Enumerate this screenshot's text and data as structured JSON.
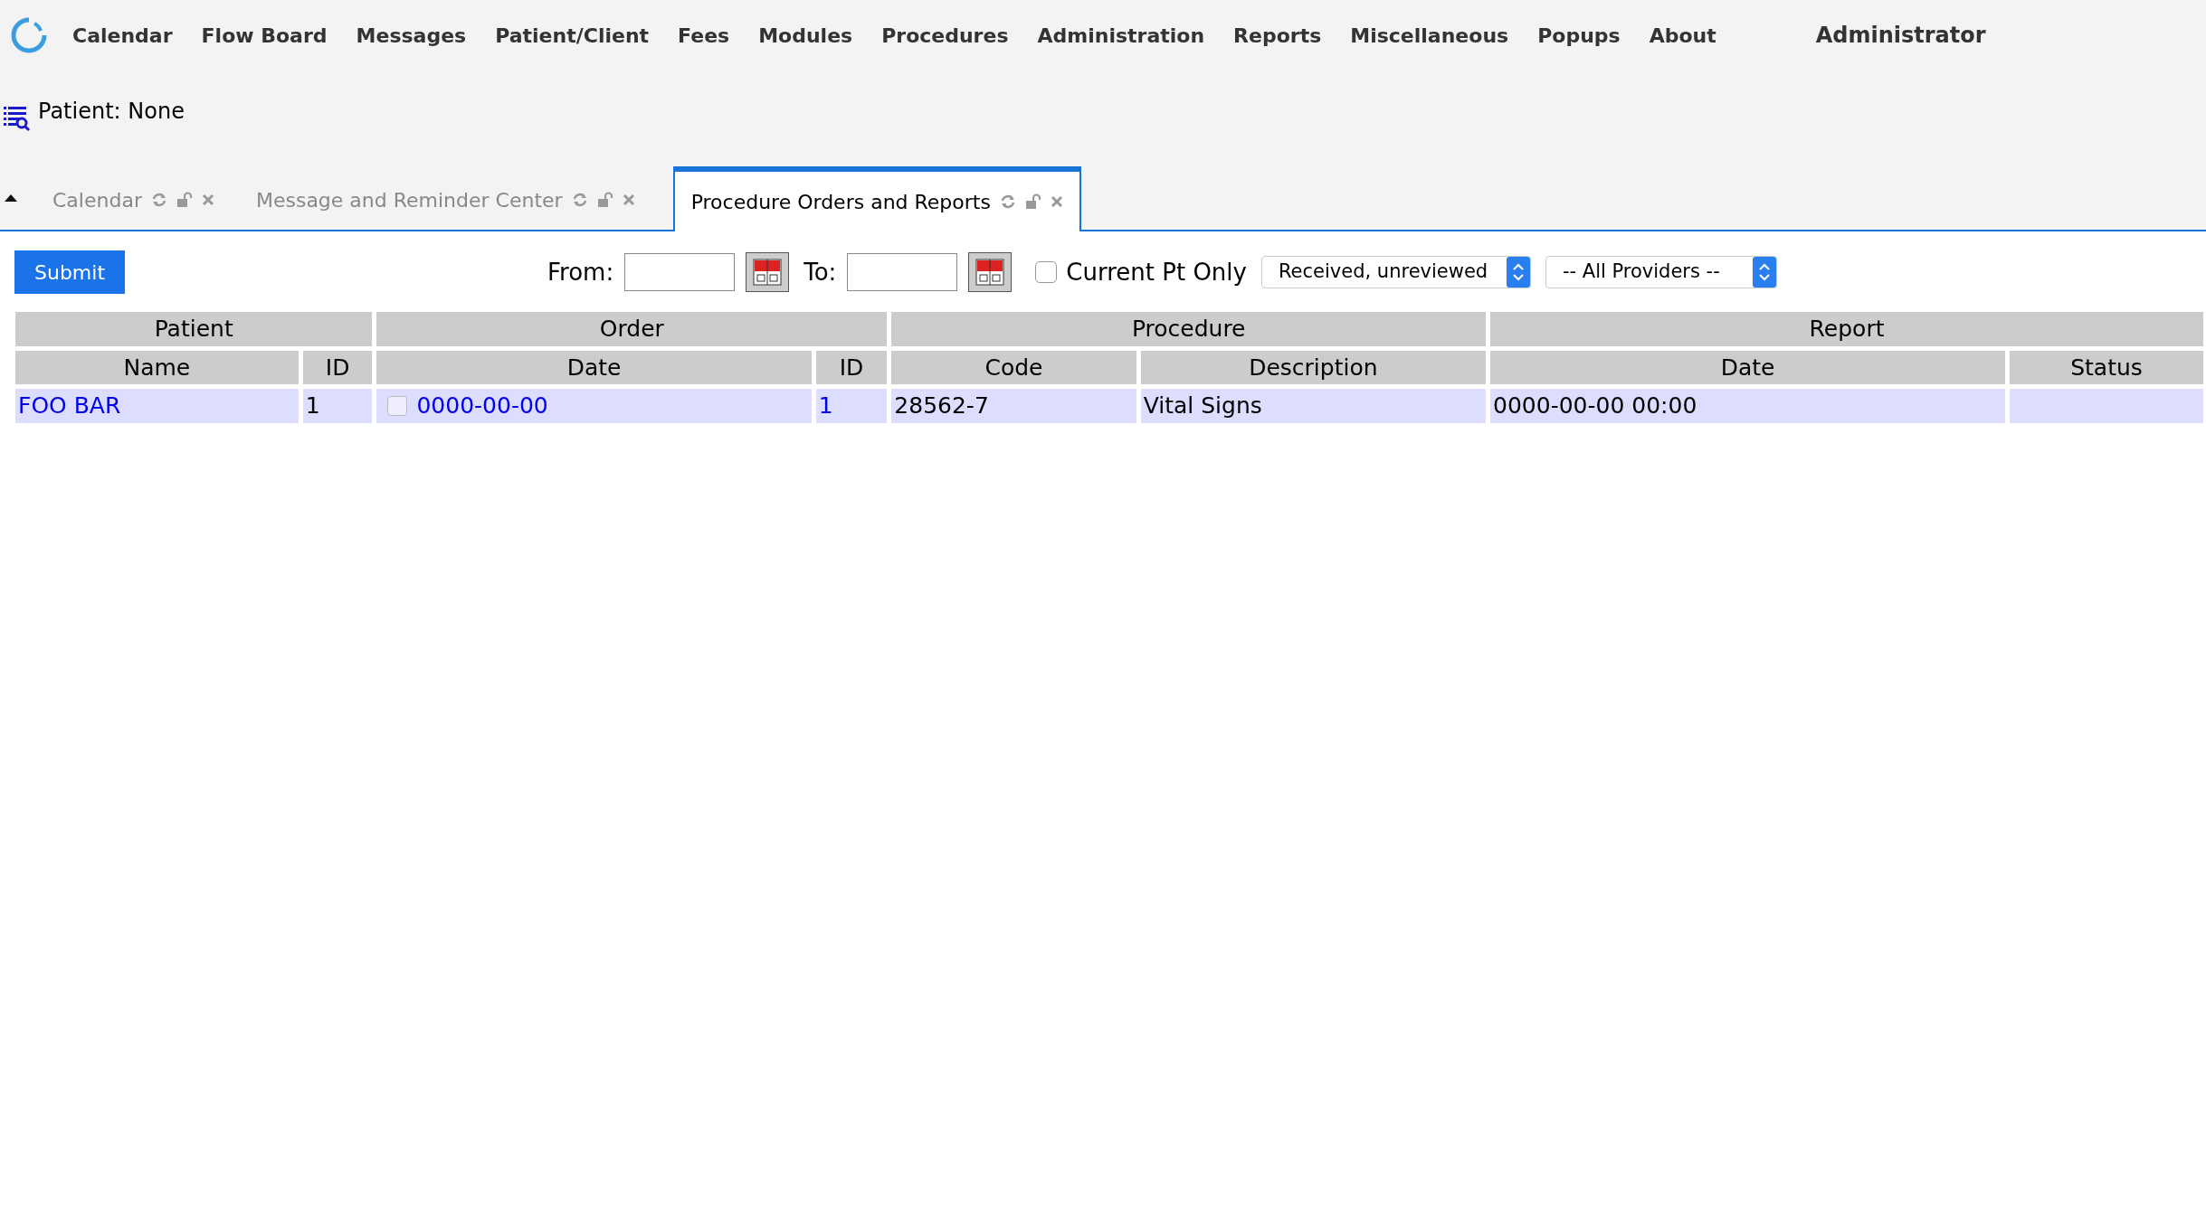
{
  "menu": {
    "items": [
      "Calendar",
      "Flow Board",
      "Messages",
      "Patient/Client",
      "Fees",
      "Modules",
      "Procedures",
      "Administration",
      "Reports",
      "Miscellaneous",
      "Popups",
      "About"
    ],
    "user": "Administrator"
  },
  "patient_bar": {
    "text": "Patient: None"
  },
  "tabs": [
    {
      "label": "Calendar",
      "selected": false
    },
    {
      "label": "Message and Reminder Center",
      "selected": false
    },
    {
      "label": "Procedure Orders and Reports",
      "selected": true
    }
  ],
  "filters": {
    "submit": "Submit",
    "from_label": "From:",
    "to_label": "To:",
    "current_pt_only": {
      "label": "Current Pt Only",
      "checked": false
    },
    "status_select": "Received, unreviewed",
    "provider_select": "-- All Providers --"
  },
  "table": {
    "groups": [
      {
        "label": "Patient",
        "columns": [
          "Name",
          "ID"
        ]
      },
      {
        "label": "Order",
        "columns": [
          "Date",
          "ID"
        ]
      },
      {
        "label": "Procedure",
        "columns": [
          "Code",
          "Description"
        ]
      },
      {
        "label": "Report",
        "columns": [
          "Date",
          "Status"
        ]
      }
    ],
    "rows": [
      {
        "name": "FOO BAR",
        "patient_id": "1",
        "order_checked": false,
        "order_date": "0000-00-00",
        "order_id": "1",
        "code": "28562-7",
        "description": "Vital Signs",
        "report_date": "0000-00-00 00:00"
      }
    ]
  }
}
